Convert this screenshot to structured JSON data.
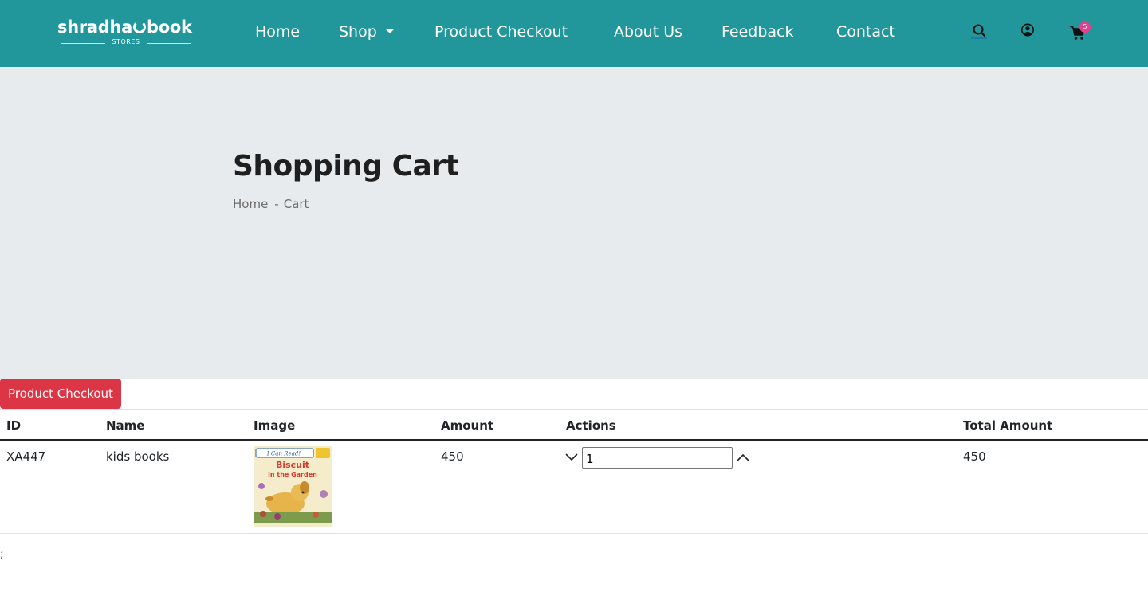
{
  "brand": {
    "name_part1": "shradha",
    "name_part2": "book",
    "tagline": "STORES"
  },
  "nav": {
    "items": [
      {
        "label": "Home"
      },
      {
        "label": "Shop"
      },
      {
        "label": "Product Checkout"
      },
      {
        "label": "About Us"
      },
      {
        "label": "Feedback"
      },
      {
        "label": "Contact"
      }
    ],
    "cart_count": "5"
  },
  "hero": {
    "title": "Shopping Cart",
    "breadcrumb": [
      "Home",
      "-",
      "Cart"
    ]
  },
  "checkout_button": "Product Checkout",
  "table": {
    "headers": [
      "ID",
      "Name",
      "Image",
      "Amount",
      "Actions",
      "Total Amount"
    ],
    "rows": [
      {
        "id": "XA447",
        "name": "kids books",
        "amount": "450",
        "quantity": "1",
        "total": "450",
        "image_title": "Biscuit in the Garden",
        "image_series": "I Can Read!"
      }
    ]
  },
  "stray_text": ";",
  "colors": {
    "header": "#21979b",
    "hero_bg": "#e8ebee",
    "checkout_button": "#dc3545",
    "badge": "#e83e8c"
  }
}
